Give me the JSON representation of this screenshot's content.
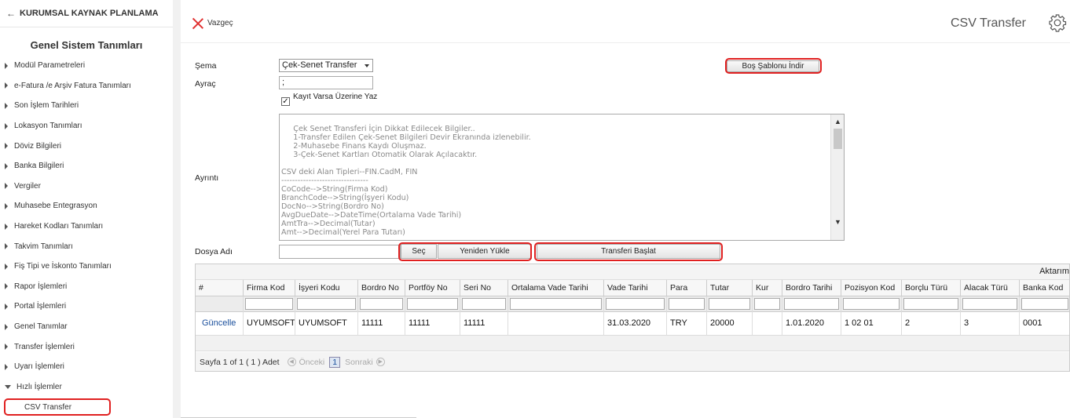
{
  "sidebar": {
    "back_label": "KURUMSAL KAYNAK PLANLAMA",
    "section_title": "Genel Sistem Tanımları",
    "items": [
      {
        "label": "Modül Parametreleri"
      },
      {
        "label": "e-Fatura /e Arşiv Fatura Tanımları"
      },
      {
        "label": "Son İşlem Tarihleri"
      },
      {
        "label": "Lokasyon Tanımları"
      },
      {
        "label": "Döviz Bilgileri"
      },
      {
        "label": "Banka Bilgileri"
      },
      {
        "label": "Vergiler"
      },
      {
        "label": "Muhasebe Entegrasyon"
      },
      {
        "label": "Hareket Kodları Tanımları"
      },
      {
        "label": "Takvim Tanımları"
      },
      {
        "label": "Fiş Tipi ve İskonto Tanımları"
      },
      {
        "label": "Rapor İşlemleri"
      },
      {
        "label": "Portal İşlemleri"
      },
      {
        "label": "Genel Tanımlar"
      },
      {
        "label": "Transfer İşlemleri"
      },
      {
        "label": "Uyarı İşlemleri"
      },
      {
        "label": "Hızlı İşlemler"
      }
    ],
    "active_sub": "CSV Transfer"
  },
  "toolbar": {
    "cancel_label": "Vazgeç",
    "page_title": "CSV Transfer"
  },
  "form": {
    "schema_label": "Şema",
    "schema_value": "Çek-Senet Transfer",
    "separator_label": "Ayraç",
    "separator_value": ";",
    "overwrite_label": "Kayıt Varsa Üzerine Yaz",
    "overwrite_checked": "✓",
    "detail_label": "Ayrıntı",
    "detail_text": "\n     Çek Senet Transferi İçin Dikkat Edilecek Bilgiler..\n     1-Transfer Edilen Çek-Senet Bilgileri Devir Ekranında izlenebilir.\n     2-Muhasebe Finans Kaydı Oluşmaz.\n     3-Çek-Senet Kartları Otomatik Olarak Açılacaktır.\n\nCSV deki Alan Tipleri--FIN.CadM, FIN\n--------------------------------\nCoCode-->String(Firma Kod)\nBranchCode-->String(İşyeri Kodu)\nDocNo-->String(Bordro No)\nAvgDueDate-->DateTime(Ortalama Vade Tarihi)\nAmtTra-->Decimal(Tutar)\nAmt-->Decimal(Yerel Para Tutarı)",
    "file_label": "Dosya Adı",
    "file_value": "",
    "download_template_label": "Boş Şablonu İndir",
    "choose_label": "Seç",
    "reload_label": "Yeniden Yükle",
    "start_transfer_label": "Transferi Başlat"
  },
  "grid": {
    "group_header": "Aktarım",
    "columns": [
      {
        "label": "#"
      },
      {
        "label": "Firma Kod"
      },
      {
        "label": "İşyeri Kodu"
      },
      {
        "label": "Bordro No"
      },
      {
        "label": "Portföy No"
      },
      {
        "label": "Seri No"
      },
      {
        "label": "Ortalama Vade Tarihi"
      },
      {
        "label": "Vade Tarihi"
      },
      {
        "label": "Para"
      },
      {
        "label": "Tutar"
      },
      {
        "label": "Kur"
      },
      {
        "label": "Bordro Tarihi"
      },
      {
        "label": "Pozisyon Kod"
      },
      {
        "label": "Borçlu Türü"
      },
      {
        "label": "Alacak Türü"
      },
      {
        "label": "Banka Kod"
      }
    ],
    "rows": [
      [
        "Güncelle",
        "UYUMSOFT",
        "UYUMSOFT",
        "11111",
        "11111",
        "11111",
        "",
        "31.03.2020",
        "TRY",
        "20000",
        "",
        "1.01.2020",
        "1 02 01",
        "2",
        "3",
        "0001"
      ]
    ],
    "pager": {
      "summary": "Sayfa 1 of 1 ( 1 ) Adet",
      "prev": "Önceki",
      "current": "1",
      "next": "Sonraki"
    }
  }
}
